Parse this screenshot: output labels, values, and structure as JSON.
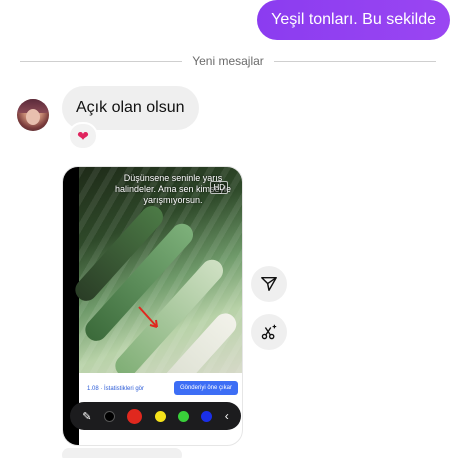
{
  "messages": {
    "sent_text": "Yeşil tonları. Bu sekilde",
    "divider_label": "Yeni mesajlar",
    "received_text": "Açık olan olsun",
    "reaction": "❤"
  },
  "media": {
    "overlay_text": "Düşünsene seninle yarış halindeler. Ama sen kimseyle yarışmıyorsun.",
    "hd_badge": "HD",
    "stats_link": "1.08 · İstatistikleri gör",
    "boost_button": "Gönderiyi öne çıkar"
  },
  "toolbar": {
    "pen_icon": "pencil-icon",
    "colors": [
      "#000000",
      "#e0281e",
      "#f5e21a",
      "#39d13a",
      "#1a2fe8"
    ],
    "back_icon": "chevron-left-icon"
  },
  "actions": {
    "share_icon": "send-icon",
    "remix_icon": "scissors-sparkle-icon"
  },
  "colors": {
    "sent_bubble": "#8b3cf0",
    "received_bubble": "#efefef"
  }
}
